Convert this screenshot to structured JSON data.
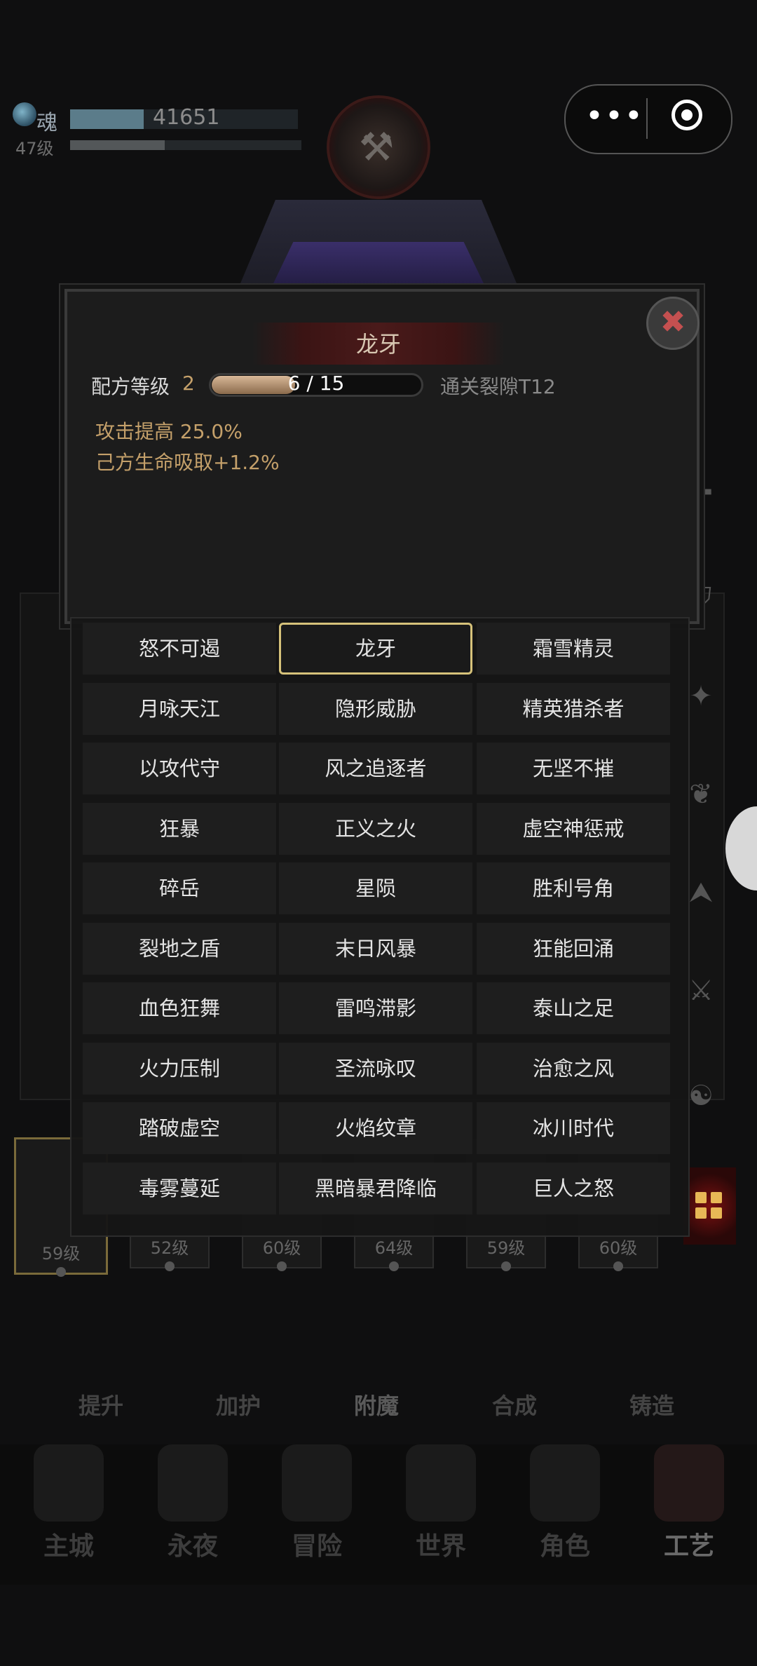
{
  "topbar": {
    "soul_label": "魂",
    "soul_value": "41651",
    "level": "47级",
    "capsule_dots": "•••"
  },
  "modal": {
    "title": "龙牙",
    "recipe_label": "配方等级",
    "recipe_level": "2",
    "progress_text": "6 / 15",
    "progress_fraction": 0.4,
    "unlock_text": "通关裂隙T12",
    "effects": [
      "攻击提高 25.0%",
      "己方生命吸取+1.2%"
    ],
    "close_symbol": "✖"
  },
  "dropdown": {
    "selected": "龙牙",
    "options": [
      [
        "怒不可遏",
        "龙牙",
        "霜雪精灵"
      ],
      [
        "月咏天江",
        "隐形威胁",
        "精英猎杀者"
      ],
      [
        "以攻代守",
        "风之追逐者",
        "无坚不摧"
      ],
      [
        "狂暴",
        "正义之火",
        "虚空神惩戒"
      ],
      [
        "碎岳",
        "星陨",
        "胜利号角"
      ],
      [
        "裂地之盾",
        "末日风暴",
        "狂能回涌"
      ],
      [
        "血色狂舞",
        "雷鸣滞影",
        "泰山之足"
      ],
      [
        "火力压制",
        "圣流咏叹",
        "治愈之风"
      ],
      [
        "踏破虚空",
        "火焰纹章",
        "冰川时代"
      ],
      [
        "毒雾蔓延",
        "黑暗暴君降临",
        "巨人之怒"
      ]
    ]
  },
  "cards": [
    "59级",
    "52级",
    "60级",
    "64级",
    "59级",
    "60级"
  ],
  "subtabs": [
    "提升",
    "加护",
    "附魔",
    "合成",
    "铸造"
  ],
  "nav": [
    "主城",
    "永夜",
    "冒险",
    "世界",
    "角色",
    "工艺"
  ],
  "colors": {
    "accent_gold": "#c4a06a",
    "selected_border": "#d6c27a",
    "close_red": "#c45050"
  }
}
